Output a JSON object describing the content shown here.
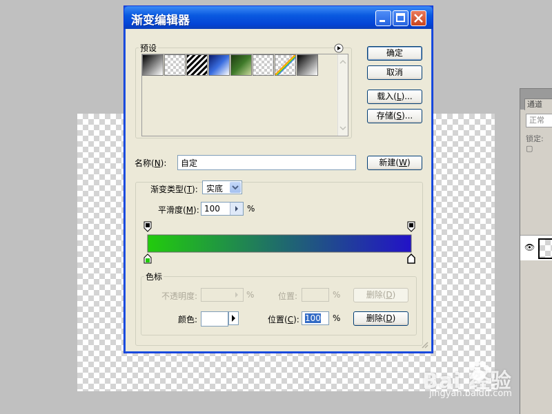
{
  "dialog": {
    "title": "渐变编辑器",
    "presets_label": "预设",
    "swatches": [
      {
        "name": "foreground-to-background",
        "colors": [
          "#000000",
          "#ffffff"
        ]
      },
      {
        "name": "foreground-to-transparent",
        "colors": [
          "#000000",
          "transparent"
        ]
      },
      {
        "name": "black-white-stripes",
        "colors": [
          "#000000",
          "#ffffff"
        ]
      },
      {
        "name": "blue-white-blue",
        "colors": [
          "#0a1a6a",
          "#3a6ee0",
          "#ffffff"
        ]
      },
      {
        "name": "green-yellow",
        "colors": [
          "#1e3a10",
          "#3f7a2a",
          "#c8d89c"
        ]
      },
      {
        "name": "transparent-stripes",
        "colors": [
          "transparent"
        ]
      },
      {
        "name": "transparent-rainbow",
        "colors": [
          "#ff8000",
          "#4080ff"
        ]
      },
      {
        "name": "black-to-white",
        "colors": [
          "#000000",
          "#ffffff"
        ]
      }
    ],
    "ok": "确定",
    "cancel": "取消",
    "load": "载入(",
    "load_key": "L",
    "load_end": ")...",
    "save": "存储(",
    "save_key": "S",
    "save_end": ")...",
    "name_label": "名称(",
    "name_key": "N",
    "name_end": "):",
    "name_value": "自定",
    "new": "新建(",
    "new_key": "W",
    "new_end": ")",
    "gradient_type_label": "渐变类型(",
    "gradient_type_key": "T",
    "gradient_type_end": "):",
    "gradient_type_value": "实底",
    "smoothness_label": "平滑度(",
    "smoothness_key": "M",
    "smoothness_end": "):",
    "smoothness_value": "100",
    "smoothness_unit": "%",
    "gradient_colors": [
      "#22cc0c",
      "#1f6c6b",
      "#2212c8"
    ],
    "color_stops": {
      "group_label": "色标",
      "opacity_label": "不透明度:",
      "opacity_unit": "%",
      "opacity_position_label": "位置:",
      "opacity_position_unit": "%",
      "delete_disabled": "删除(",
      "delete_key": "D",
      "delete_end": ")",
      "color_label": "颜色:",
      "color_swatch": "#ffffff",
      "position_label": "位置(",
      "position_key": "C",
      "position_end": "):",
      "position_value": "100",
      "position_unit": "%",
      "delete_label": "删除(",
      "delete_label_key": "D",
      "delete_label_end": ")"
    }
  },
  "panel": {
    "tab": "通道",
    "mode": "正常",
    "lock": "锁定: ▢"
  },
  "watermark": {
    "brand": "Bai  经验",
    "url": "jingyan.baidu.com"
  }
}
